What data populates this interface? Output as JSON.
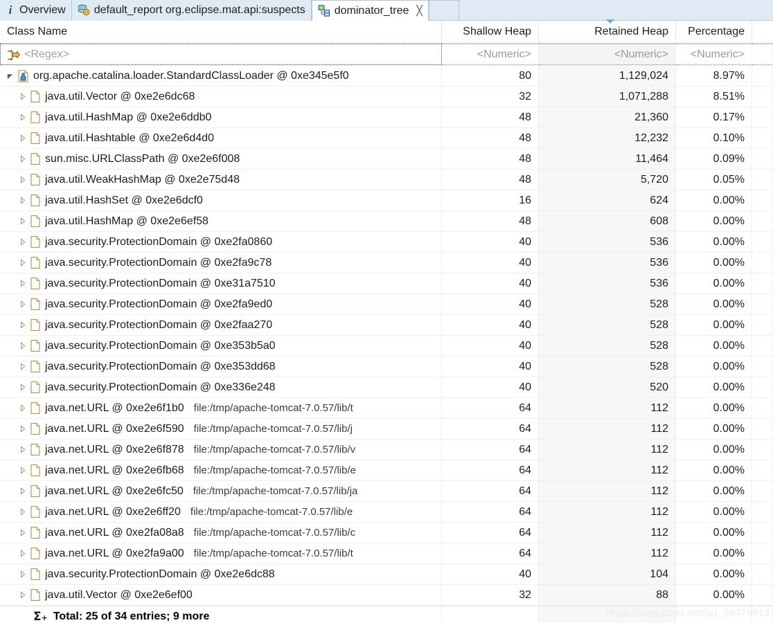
{
  "tabs": [
    {
      "label": "Overview",
      "icon": "info-icon",
      "active": false,
      "closable": false
    },
    {
      "label": "default_report  org.eclipse.mat.api:suspects",
      "icon": "report-icon",
      "active": false,
      "closable": false
    },
    {
      "label": "dominator_tree",
      "icon": "tree-icon",
      "active": true,
      "closable": true,
      "close_glyph": "╳"
    }
  ],
  "columns": [
    {
      "key": "name",
      "label": "Class Name",
      "align": "left",
      "sorted": false
    },
    {
      "key": "shallow",
      "label": "Shallow Heap",
      "align": "right",
      "sorted": false
    },
    {
      "key": "retained",
      "label": "Retained Heap",
      "align": "right",
      "sorted": true
    },
    {
      "key": "percentage",
      "label": "Percentage",
      "align": "right",
      "sorted": false
    }
  ],
  "filter_row": {
    "icon": "filter-regex-icon",
    "name": "<Regex>",
    "shallow": "<Numeric>",
    "retained": "<Numeric>",
    "percentage": "<Numeric>"
  },
  "rows": [
    {
      "indent": 0,
      "expander": "expanded",
      "icon": "classloader-icon",
      "name": "org.apache.catalina.loader.StandardClassLoader @ 0xe345e5f0",
      "sub": "",
      "shallow": "80",
      "retained": "1,129,024",
      "percentage": "8.97%"
    },
    {
      "indent": 1,
      "expander": "collapsed",
      "icon": "object-icon",
      "name": "java.util.Vector @ 0xe2e6dc68",
      "sub": "",
      "shallow": "32",
      "retained": "1,071,288",
      "percentage": "8.51%"
    },
    {
      "indent": 1,
      "expander": "collapsed",
      "icon": "object-icon",
      "name": "java.util.HashMap @ 0xe2e6ddb0",
      "sub": "",
      "shallow": "48",
      "retained": "21,360",
      "percentage": "0.17%"
    },
    {
      "indent": 1,
      "expander": "collapsed",
      "icon": "object-icon",
      "name": "java.util.Hashtable @ 0xe2e6d4d0",
      "sub": "",
      "shallow": "48",
      "retained": "12,232",
      "percentage": "0.10%"
    },
    {
      "indent": 1,
      "expander": "collapsed",
      "icon": "object-icon",
      "name": "sun.misc.URLClassPath @ 0xe2e6f008",
      "sub": "",
      "shallow": "48",
      "retained": "11,464",
      "percentage": "0.09%"
    },
    {
      "indent": 1,
      "expander": "collapsed",
      "icon": "object-icon",
      "name": "java.util.WeakHashMap @ 0xe2e75d48",
      "sub": "",
      "shallow": "48",
      "retained": "5,720",
      "percentage": "0.05%"
    },
    {
      "indent": 1,
      "expander": "collapsed",
      "icon": "object-icon",
      "name": "java.util.HashSet @ 0xe2e6dcf0",
      "sub": "",
      "shallow": "16",
      "retained": "624",
      "percentage": "0.00%"
    },
    {
      "indent": 1,
      "expander": "collapsed",
      "icon": "object-icon",
      "name": "java.util.HashMap @ 0xe2e6ef58",
      "sub": "",
      "shallow": "48",
      "retained": "608",
      "percentage": "0.00%"
    },
    {
      "indent": 1,
      "expander": "collapsed",
      "icon": "object-icon",
      "name": "java.security.ProtectionDomain @ 0xe2fa0860",
      "sub": "",
      "shallow": "40",
      "retained": "536",
      "percentage": "0.00%"
    },
    {
      "indent": 1,
      "expander": "collapsed",
      "icon": "object-icon",
      "name": "java.security.ProtectionDomain @ 0xe2fa9c78",
      "sub": "",
      "shallow": "40",
      "retained": "536",
      "percentage": "0.00%"
    },
    {
      "indent": 1,
      "expander": "collapsed",
      "icon": "object-icon",
      "name": "java.security.ProtectionDomain @ 0xe31a7510",
      "sub": "",
      "shallow": "40",
      "retained": "536",
      "percentage": "0.00%"
    },
    {
      "indent": 1,
      "expander": "collapsed",
      "icon": "object-icon",
      "name": "java.security.ProtectionDomain @ 0xe2fa9ed0",
      "sub": "",
      "shallow": "40",
      "retained": "528",
      "percentage": "0.00%"
    },
    {
      "indent": 1,
      "expander": "collapsed",
      "icon": "object-icon",
      "name": "java.security.ProtectionDomain @ 0xe2faa270",
      "sub": "",
      "shallow": "40",
      "retained": "528",
      "percentage": "0.00%"
    },
    {
      "indent": 1,
      "expander": "collapsed",
      "icon": "object-icon",
      "name": "java.security.ProtectionDomain @ 0xe353b5a0",
      "sub": "",
      "shallow": "40",
      "retained": "528",
      "percentage": "0.00%"
    },
    {
      "indent": 1,
      "expander": "collapsed",
      "icon": "object-icon",
      "name": "java.security.ProtectionDomain @ 0xe353dd68",
      "sub": "",
      "shallow": "40",
      "retained": "528",
      "percentage": "0.00%"
    },
    {
      "indent": 1,
      "expander": "collapsed",
      "icon": "object-icon",
      "name": "java.security.ProtectionDomain @ 0xe336e248",
      "sub": "",
      "shallow": "40",
      "retained": "520",
      "percentage": "0.00%"
    },
    {
      "indent": 1,
      "expander": "collapsed",
      "icon": "object-icon",
      "name": "java.net.URL @ 0xe2e6f1b0",
      "sub": "file:/tmp/apache-tomcat-7.0.57/lib/t",
      "shallow": "64",
      "retained": "112",
      "percentage": "0.00%"
    },
    {
      "indent": 1,
      "expander": "collapsed",
      "icon": "object-icon",
      "name": "java.net.URL @ 0xe2e6f590",
      "sub": "file:/tmp/apache-tomcat-7.0.57/lib/j",
      "shallow": "64",
      "retained": "112",
      "percentage": "0.00%"
    },
    {
      "indent": 1,
      "expander": "collapsed",
      "icon": "object-icon",
      "name": "java.net.URL @ 0xe2e6f878",
      "sub": "file:/tmp/apache-tomcat-7.0.57/lib/v",
      "shallow": "64",
      "retained": "112",
      "percentage": "0.00%"
    },
    {
      "indent": 1,
      "expander": "collapsed",
      "icon": "object-icon",
      "name": "java.net.URL @ 0xe2e6fb68",
      "sub": "file:/tmp/apache-tomcat-7.0.57/lib/e",
      "shallow": "64",
      "retained": "112",
      "percentage": "0.00%"
    },
    {
      "indent": 1,
      "expander": "collapsed",
      "icon": "object-icon",
      "name": "java.net.URL @ 0xe2e6fc50",
      "sub": "file:/tmp/apache-tomcat-7.0.57/lib/ja",
      "shallow": "64",
      "retained": "112",
      "percentage": "0.00%"
    },
    {
      "indent": 1,
      "expander": "collapsed",
      "icon": "object-icon",
      "name": "java.net.URL @ 0xe2e6ff20",
      "sub": "file:/tmp/apache-tomcat-7.0.57/lib/e",
      "shallow": "64",
      "retained": "112",
      "percentage": "0.00%"
    },
    {
      "indent": 1,
      "expander": "collapsed",
      "icon": "object-icon",
      "name": "java.net.URL @ 0xe2fa08a8",
      "sub": "file:/tmp/apache-tomcat-7.0.57/lib/c",
      "shallow": "64",
      "retained": "112",
      "percentage": "0.00%"
    },
    {
      "indent": 1,
      "expander": "collapsed",
      "icon": "object-icon",
      "name": "java.net.URL @ 0xe2fa9a00",
      "sub": "file:/tmp/apache-tomcat-7.0.57/lib/t",
      "shallow": "64",
      "retained": "112",
      "percentage": "0.00%"
    },
    {
      "indent": 1,
      "expander": "collapsed",
      "icon": "object-icon",
      "name": "java.security.ProtectionDomain @ 0xe2e6dc88",
      "sub": "",
      "shallow": "40",
      "retained": "104",
      "percentage": "0.00%"
    },
    {
      "indent": 1,
      "expander": "collapsed",
      "icon": "object-icon",
      "name": "java.util.Vector @ 0xe2e6ef00",
      "sub": "",
      "shallow": "32",
      "retained": "88",
      "percentage": "0.00%"
    }
  ],
  "footer": {
    "icon": "sum-icon",
    "text": "Total: 25 of 34 entries; 9 more"
  },
  "watermark": "https://blog.csdn.net/qq_36079912",
  "colors": {
    "tab_inactive_bg": "#dfeaf4",
    "tab_border": "#b6c6d6",
    "sort_arrow": "#68b3d8",
    "sorted_column_bg": "#f7f7f7",
    "text": "#1d1d1d",
    "placeholder": "#a0a0a0",
    "watermark": "#ededed"
  }
}
